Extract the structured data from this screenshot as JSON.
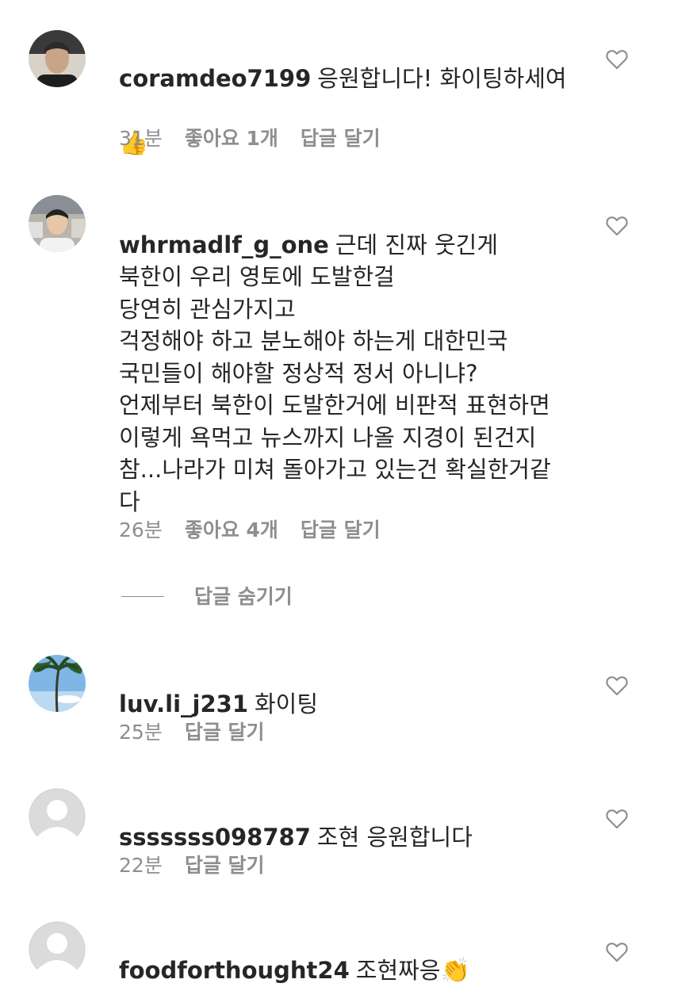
{
  "comments": [
    {
      "username": "coramdeo7199",
      "text": "응원합니다! 화이팅하세여",
      "emoji": "👍",
      "emoji_icon": "thumbs-up-icon",
      "time": "31분",
      "likes": "좋아요 1개",
      "reply": "답글 달기"
    },
    {
      "username": "whrmadlf_g_one",
      "text": "근데 진짜 웃긴게\n북한이 우리 영토에 도발한걸\n당연히 관심가지고\n걱정해야 하고 분노해야 하는게 대한민국\n국민들이 해야할 정상적 정서 아니냐?\n언제부터 북한이 도발한거에 비판적 표현하면\n이렇게 욕먹고 뉴스까지 나올 지경이 된건지\n참...나라가 미쳐 돌아가고 있는건 확실한거같\n다",
      "time": "26분",
      "likes": "좋아요 4개",
      "reply": "답글 달기"
    },
    {
      "username": "luv.li_j231",
      "text": "화이팅",
      "time": "25분",
      "reply": "답글 달기"
    },
    {
      "username": "sssssss098787",
      "text": "조현 응원합니다",
      "time": "22분",
      "reply": "답글 달기"
    },
    {
      "username": "foodforthought24",
      "text": "조현짜응",
      "emoji": "👏",
      "emoji_icon": "clapping-hands-icon"
    }
  ],
  "hide_replies_label": "답글 숨기기",
  "colors": {
    "text": "#262626",
    "meta": "#8e8e8e",
    "heart_outline": "#8e8e8e",
    "default_avatar_bg": "#dbdbdb"
  }
}
